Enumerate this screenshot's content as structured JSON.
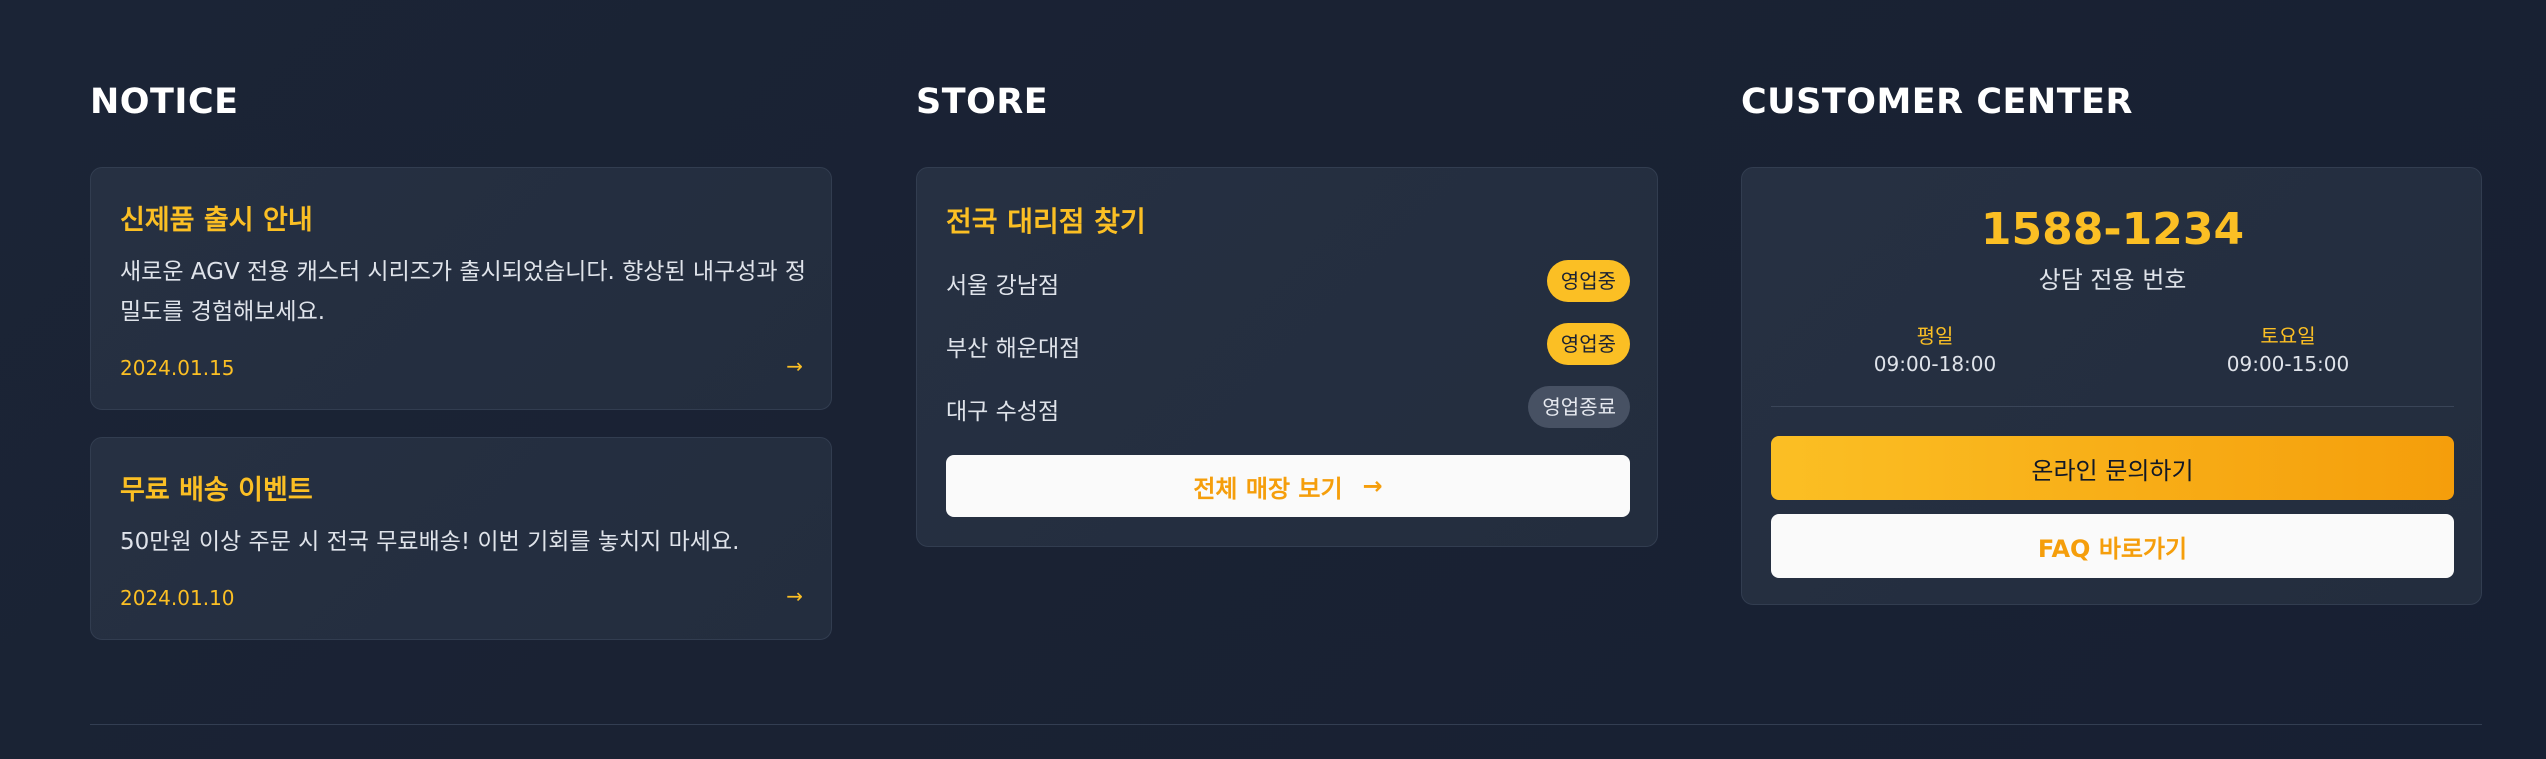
{
  "notice": {
    "title": "NOTICE",
    "items": [
      {
        "title": "신제품 출시 안내",
        "description": "새로운 AGV 전용 캐스터 시리즈가 출시되었습니다. 향상된 내구성과 정밀도를 경험해보세요.",
        "date": "2024.01.15",
        "arrow_icon": "arrow-right-icon"
      },
      {
        "title": "무료 배송 이벤트",
        "description": "50만원 이상 주문 시 전국 무료배송! 이번 기회를 놓치지 마세요.",
        "date": "2024.01.10",
        "arrow_icon": "arrow-right-icon"
      }
    ]
  },
  "store": {
    "title": "STORE",
    "heading": "전국 대리점 찾기",
    "stores": [
      {
        "name": "서울 강남점",
        "status": "영업중",
        "open": true
      },
      {
        "name": "부산 해운대점",
        "status": "영업중",
        "open": true
      },
      {
        "name": "대구 수성점",
        "status": "영업종료",
        "open": false
      }
    ],
    "view_all_label": "전체 매장 보기",
    "view_all_icon": "arrow-right-icon"
  },
  "customer_center": {
    "title": "CUSTOMER CENTER",
    "phone": "1588-1234",
    "phone_label": "상담 전용 번호",
    "hours": [
      {
        "day": "평일",
        "time": "09:00-18:00"
      },
      {
        "day": "토요일",
        "time": "09:00-15:00"
      }
    ],
    "inquiry_label": "온라인 문의하기",
    "faq_label": "FAQ 바로가기"
  },
  "colors": {
    "accent": "#fbbf24",
    "accent_dark": "#f59e0b",
    "background": "#1b2436",
    "card": "#263042",
    "badge_closed": "#475163"
  }
}
